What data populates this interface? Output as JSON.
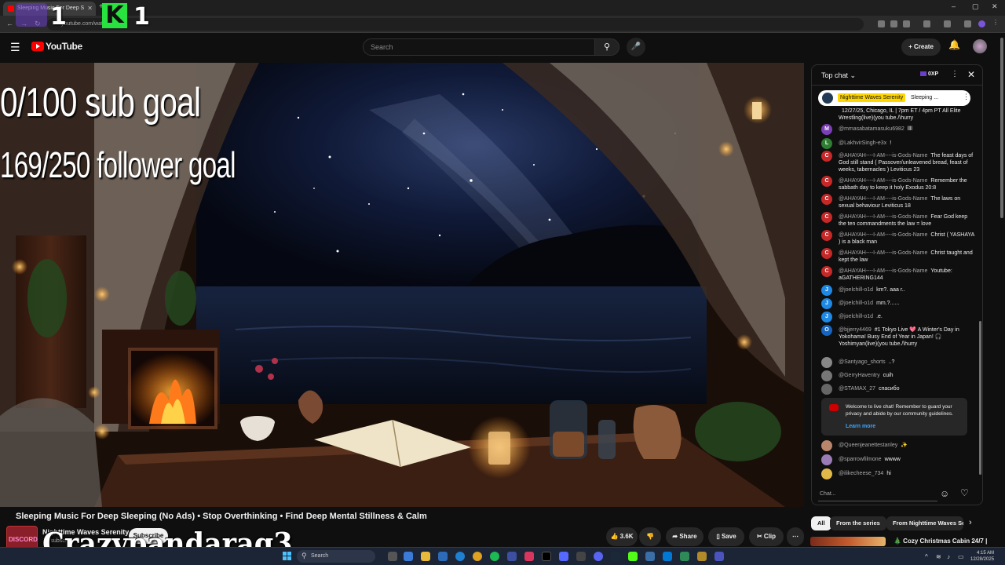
{
  "browser": {
    "tab_title": "Sleeping Music For Deep S",
    "url": "youtube.com/wat... UCl-s...",
    "win": {
      "minimize": "–",
      "maximize": "▢",
      "close": "✕"
    }
  },
  "overlay": {
    "count_a": "1",
    "kick_letter": "K",
    "count_b": "1",
    "sub_goal": "0/100 sub goal",
    "follower_goal": "169/250 follower goal",
    "streamer_name": "Crazypandarag3"
  },
  "header": {
    "logo_text": "YouTube",
    "search_placeholder": "Search",
    "create_label": "+ Create"
  },
  "video": {
    "title": "Sleeping Music For Deep Sleeping (No Ads) • Stop Overthinking • Find Deep Mental Stillness & Calm",
    "channel_name": "Nighttime Waves Serenity",
    "channel_badge": "DISCORD",
    "subscribers": "1K subsc...",
    "subscribe_label": "Subscribe",
    "likes": "3.6K",
    "share_label": "Share",
    "save_label": "Save",
    "clip_label": "Clip"
  },
  "chat": {
    "title": "Top chat",
    "xp": "0XP",
    "pinned": {
      "author": "Nighttime Waves Serenity",
      "text": "Sleeping ..."
    },
    "messages": [
      {
        "initial": "",
        "color": "#1f1f1f",
        "author": "",
        "text": "12/27/25, Chicago, IL | 7pm ET / 4pm PT All Elite Wrestling(live)(you tube./\\hurry"
      },
      {
        "initial": "M",
        "color": "#7b3fb5",
        "author": "@mmasabatamasuku6982",
        "text": "llll"
      },
      {
        "initial": "L",
        "color": "#2e7d32",
        "author": "@LakhvirSingh-e3x",
        "text": "!"
      },
      {
        "initial": "C",
        "color": "#c62828",
        "author": "@AHAYAH----I-AM----is-Gods-Name",
        "text": "The feast days of God still stand ( Passover/unleavened bread, feast of weeks, tabernacles ) Leviticus 23"
      },
      {
        "initial": "C",
        "color": "#c62828",
        "author": "@AHAYAH----I-AM----is-Gods-Name",
        "text": "Remember the sabbath day to keep it holy Exodus 20:8"
      },
      {
        "initial": "C",
        "color": "#c62828",
        "author": "@AHAYAH----I-AM----is-Gods-Name",
        "text": "The laws on sexual behaviour Leviticus 18"
      },
      {
        "initial": "C",
        "color": "#c62828",
        "author": "@AHAYAH----I-AM----is-Gods-Name",
        "text": "Fear God keep the ten commandments the law = love"
      },
      {
        "initial": "C",
        "color": "#c62828",
        "author": "@AHAYAH----I-AM----is-Gods-Name",
        "text": "Christ ( YASHAYA ) is a black man"
      },
      {
        "initial": "C",
        "color": "#c62828",
        "author": "@AHAYAH----I-AM----is-Gods-Name",
        "text": "Christ taught and kept the law"
      },
      {
        "initial": "C",
        "color": "#c62828",
        "author": "@AHAYAH----I-AM----is-Gods-Name",
        "text": "Youtube: aGATHERING144"
      },
      {
        "initial": "J",
        "color": "#1e88e5",
        "author": "@joelchill-o1d",
        "text": "km?. aaa r.."
      },
      {
        "initial": "J",
        "color": "#1e88e5",
        "author": "@joelchill-o1d",
        "text": "mm.?......"
      },
      {
        "initial": "J",
        "color": "#1e88e5",
        "author": "@joelchill-o1d",
        "text": ".e."
      },
      {
        "initial": "O",
        "color": "#1565c0",
        "author": "@bjjerry4469",
        "text": "#1 Tokyo Live 💖 A Winter's Day in Yokohama! Busy End of Year in Japan! 🎧 Yoshimyan(live)(you tube./\\hurry"
      },
      {
        "initial": "",
        "color": "#888888",
        "author": "@Santyago_shorts",
        "text": "..?"
      },
      {
        "initial": "",
        "color": "#777777",
        "author": "@GerryHaventry",
        "text": "cuih"
      },
      {
        "initial": "",
        "color": "#666666",
        "author": "@STAMAX_27",
        "text": "спасибо"
      }
    ],
    "notice_text": "Welcome to live chat! Remember to guard your privacy and abide by our community guidelines.",
    "notice_link": "Learn more",
    "messages_after": [
      {
        "initial": "",
        "color": "#b8866b",
        "author": "@Queenjeanettestanley",
        "text": "✨"
      },
      {
        "initial": "",
        "color": "#9b7bb5",
        "author": "@sparrowfilmone",
        "text": "wwww"
      },
      {
        "initial": "",
        "color": "#e0b84a",
        "author": "@ilikecheese_734",
        "text": "hi"
      }
    ],
    "input_placeholder": "Chat..."
  },
  "chips": {
    "all": "All",
    "series": "From the series",
    "channel": "From Nighttime Waves Se"
  },
  "recommendation": {
    "title": "🎄 Cozy Christmas Cabin 24/7 |"
  },
  "taskbar": {
    "search_placeholder": "Search",
    "time": "4:15 AM",
    "date": "12/28/2025"
  }
}
